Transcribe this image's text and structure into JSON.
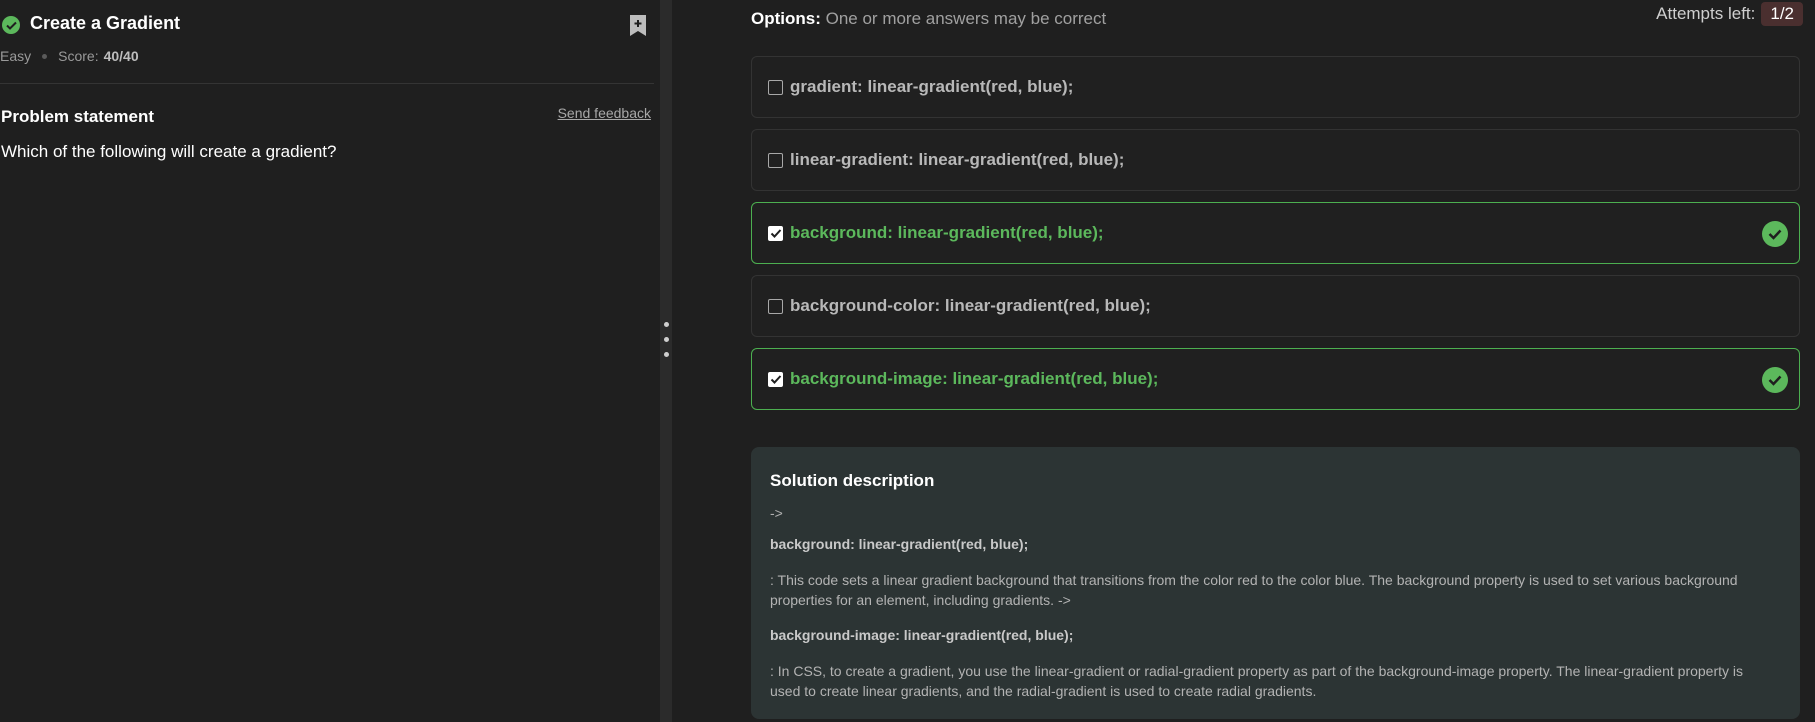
{
  "problem": {
    "title": "Create a Gradient",
    "difficulty": "Easy",
    "score_label": "Score:",
    "score_value": "40/40",
    "statement_title": "Problem statement",
    "send_feedback": "Send feedback",
    "question": "Which of the following will create a gradient?"
  },
  "options_header": {
    "label": "Options:",
    "hint": "One or more answers may be correct",
    "attempts_label": "Attempts left:",
    "attempts_value": "1/2"
  },
  "options": [
    {
      "text": "gradient: linear-gradient(red, blue);",
      "checked": false,
      "correct": false
    },
    {
      "text": "linear-gradient: linear-gradient(red, blue);",
      "checked": false,
      "correct": false
    },
    {
      "text": "background: linear-gradient(red, blue);",
      "checked": true,
      "correct": true
    },
    {
      "text": "background-color: linear-gradient(red, blue);",
      "checked": false,
      "correct": false
    },
    {
      "text": "background-image: linear-gradient(red, blue);",
      "checked": true,
      "correct": true
    }
  ],
  "solution": {
    "title": "Solution description",
    "arrow": "->",
    "code1": "background: linear-gradient(red, blue);",
    "para1": ": This code sets a linear gradient background that transitions from the color red to the color blue. The background property is used to set various background properties for an element, including gradients. ->",
    "code2": "background-image: linear-gradient(red, blue);",
    "para2": ": In CSS, to create a gradient, you use the linear-gradient or radial-gradient property as part of the background-image property. The linear-gradient property is used to create linear gradients, and the radial-gradient is used to create radial gradients."
  },
  "colors": {
    "accent_green": "#5cb85c",
    "background": "#1f1f1f",
    "solution_bg": "#2c3434",
    "attempts_badge": "#4a2f2f"
  },
  "icons": {
    "solved": "check-circle-icon",
    "bookmark": "bookmark-plus-icon",
    "option_correct": "check-circle-icon",
    "splitter": "drag-handle-icon"
  }
}
